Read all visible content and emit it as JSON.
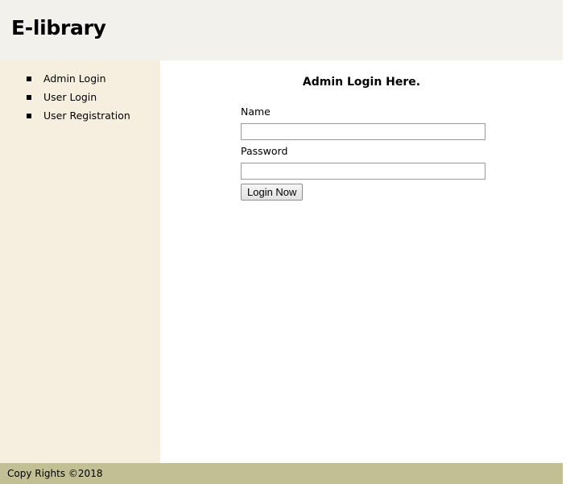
{
  "header": {
    "title": "E-library"
  },
  "sidebar": {
    "items": [
      {
        "label": "Admin Login"
      },
      {
        "label": "User Login"
      },
      {
        "label": "User Registration"
      }
    ]
  },
  "main": {
    "form_title": "Admin Login Here.",
    "name_label": "Name",
    "name_value": "",
    "password_label": "Password",
    "password_value": "",
    "submit_label": "Login Now"
  },
  "footer": {
    "text": "Copy Rights ©2018"
  },
  "colors": {
    "header_bg": "#f3f1ec",
    "sidebar_bg": "#f6efdf",
    "footer_bg": "#c1bf93",
    "main_bg": "#ffffff"
  }
}
